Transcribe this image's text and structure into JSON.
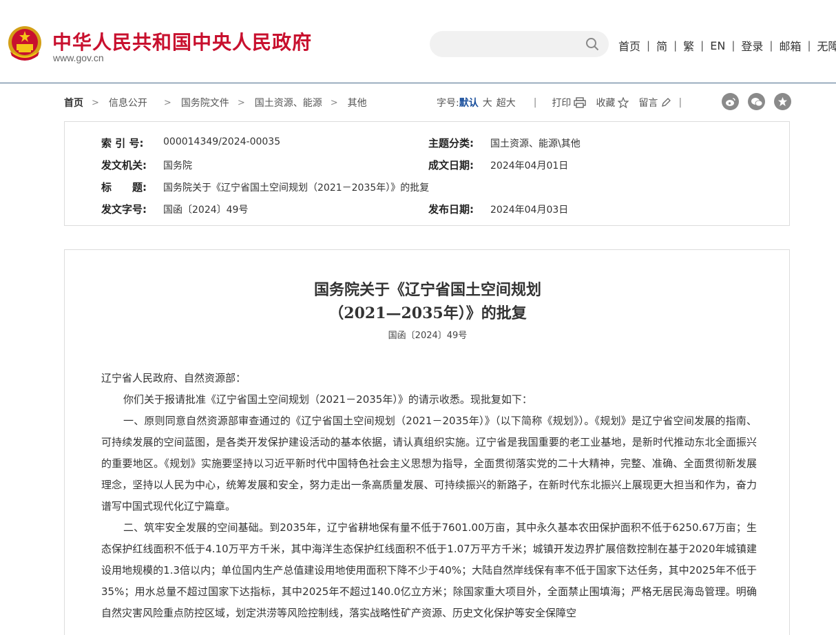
{
  "header": {
    "site_title": "中华人民共和国中央人民政府",
    "site_url": "www.gov.cn",
    "search_placeholder": "",
    "nav": [
      "首页",
      "简",
      "繁",
      "EN",
      "登录",
      "邮箱",
      "无障"
    ]
  },
  "breadcrumb": {
    "items": [
      "首页",
      "信息公开",
      "国务院文件",
      "国土资源、能源",
      "其他"
    ]
  },
  "tools": {
    "font_label": "字号:",
    "font_default": "默认",
    "font_large": "大",
    "font_xlarge": "超大",
    "print": "打印",
    "favorite": "收藏",
    "comment": "留言",
    "share_icons": [
      "weibo-icon",
      "wechat-icon",
      "star-share-icon"
    ]
  },
  "meta": {
    "index_label": "索 引 号:",
    "index_value": "000014349/2024-00035",
    "category_label": "主题分类:",
    "category_value": "国土资源、能源\\其他",
    "issuer_label": "发文机关:",
    "issuer_value": "国务院",
    "created_label": "成文日期:",
    "created_value": "2024年04月01日",
    "title_label": "标　　题:",
    "title_value": "国务院关于《辽宁省国土空间规划（2021－2035年）》的批复",
    "doc_no_label": "发文字号:",
    "doc_no_value": "国函〔2024〕49号",
    "published_label": "发布日期:",
    "published_value": "2024年04月03日"
  },
  "document": {
    "title_line1": "国务院关于《辽宁省国土空间规划",
    "title_line2": "（2021—2035年）》的批复",
    "doc_number": "国函〔2024〕49号",
    "salutation": "辽宁省人民政府、自然资源部：",
    "paragraphs": [
      "你们关于报请批准《辽宁省国土空间规划（2021－2035年）》的请示收悉。现批复如下：",
      "一、原则同意自然资源部审查通过的《辽宁省国土空间规划（2021－2035年）》（以下简称《规划》）。《规划》是辽宁省空间发展的指南、可持续发展的空间蓝图，是各类开发保护建设活动的基本依据，请认真组织实施。辽宁省是我国重要的老工业基地，是新时代推动东北全面振兴的重要地区。《规划》实施要坚持以习近平新时代中国特色社会主义思想为指导，全面贯彻落实党的二十大精神，完整、准确、全面贯彻新发展理念，坚持以人民为中心，统筹发展和安全，努力走出一条高质量发展、可持续振兴的新路子，在新时代东北振兴上展现更大担当和作为，奋力谱写中国式现代化辽宁篇章。",
      "二、筑牢安全发展的空间基础。到2035年，辽宁省耕地保有量不低于7601.00万亩，其中永久基本农田保护面积不低于6250.67万亩；生态保护红线面积不低于4.10万平方千米，其中海洋生态保护红线面积不低于1.07万平方千米；城镇开发边界扩展倍数控制在基于2020年城镇建设用地规模的1.3倍以内；单位国内生产总值建设用地使用面积下降不少于40%；大陆自然岸线保有率不低于国家下达任务，其中2025年不低于35%；用水总量不超过国家下达指标，其中2025年不超过140.0亿立方米；除国家重大项目外，全面禁止围填海；严格无居民海岛管理。明确自然灾害风险重点防控区域，划定洪涝等风险控制线，落实战略性矿产资源、历史文化保护等安全保障空"
    ]
  }
}
